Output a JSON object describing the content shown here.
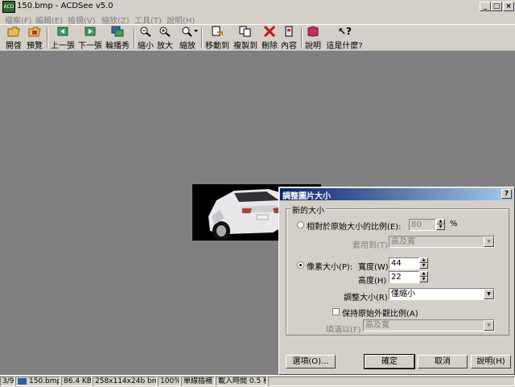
{
  "window": {
    "title": "150.bmp - ACDSee v5.0",
    "app_icon": "ACD"
  },
  "menubar": {
    "items": [
      {
        "label": "檔案(F)"
      },
      {
        "label": "編輯(E)"
      },
      {
        "label": "檢視(V)"
      },
      {
        "label": "縮放(Z)"
      },
      {
        "label": "工具(T)"
      },
      {
        "label": "說明(H)"
      }
    ]
  },
  "toolbar": {
    "items": [
      {
        "label": "開啓",
        "icon": "open-folder-icon"
      },
      {
        "label": "預覽",
        "icon": "browse-icon"
      },
      {
        "label": "上一張",
        "icon": "previous-image-icon"
      },
      {
        "label": "下一張",
        "icon": "next-image-icon"
      },
      {
        "label": "輪播秀",
        "icon": "slideshow-icon"
      },
      {
        "label": "縮小",
        "icon": "zoom-out-icon"
      },
      {
        "label": "放大",
        "icon": "zoom-in-icon"
      },
      {
        "label": "縮放",
        "icon": "zoom-icon"
      },
      {
        "label": "移動到",
        "icon": "move-to-icon"
      },
      {
        "label": "複製到",
        "icon": "copy-to-icon"
      },
      {
        "label": "刪除",
        "icon": "delete-icon"
      },
      {
        "label": "內容",
        "icon": "properties-icon"
      },
      {
        "label": "說明",
        "icon": "help-book-icon"
      },
      {
        "label": "這是什麼?",
        "icon": "whats-this-icon"
      }
    ]
  },
  "statusbar": {
    "position": "3/9",
    "filename": "150.bmp",
    "filesize": "86.4 KB",
    "dimensions": "258x114x24b bmp",
    "zoom": "100%",
    "scaling": "單線插補",
    "load_time": "載入時間 0.5 秒"
  },
  "dialog": {
    "title": "調整圖片大小",
    "help": "?",
    "group_label": "新的大小",
    "percent_label": "相對於原始大小的比例(E):",
    "percent_value": "80",
    "percent_unit": "%",
    "apply_to_label": "套用到(T)",
    "apply_to_value": "高及寬",
    "pixel_label": "像素大小(P):",
    "width_label": "寬度(W)",
    "width_value": "44",
    "height_label": "高度(H)",
    "height_value": "22",
    "resize_label": "調整大小(R)",
    "resize_value": "僅縮小",
    "keep_aspect_label": "保持原始外觀比例(A)",
    "fit_label": "填滿以(F)",
    "fit_value": "高及寬",
    "options_button": "選項(O)...",
    "ok_button": "確定",
    "cancel_button": "取消",
    "help_button": "說明(H)"
  }
}
